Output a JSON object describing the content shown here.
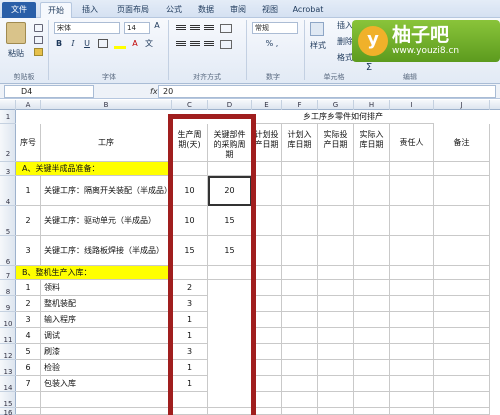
{
  "tabs": [
    "文件",
    "开始",
    "插入",
    "页面布局",
    "公式",
    "数据",
    "审阅",
    "视图",
    "Acrobat"
  ],
  "active_tab": "开始",
  "ribbon": {
    "paste_label": "粘贴",
    "font_name": "宋体",
    "font_size": "14",
    "number_format": "常规",
    "number_symbols": "% ,",
    "style_label": "样式",
    "insert_label": "插入",
    "delete_label": "删除",
    "format_label": "格式",
    "sum_symbol": "Σ",
    "bold": "B",
    "italic": "I",
    "underline": "U",
    "font_grow": "A",
    "font_color_a": "A",
    "wen": "文",
    "groups": [
      "剪贴板",
      "字体",
      "对齐方式",
      "数字",
      "单元格",
      "编辑"
    ]
  },
  "watermark": {
    "badge": "y",
    "title": "柚子吧",
    "url": "www.youzi8.cn"
  },
  "formula_bar": {
    "cell_ref": "D4",
    "fx": "fx",
    "value": "20"
  },
  "columns": [
    "A",
    "B",
    "C",
    "D",
    "E",
    "F",
    "G",
    "H",
    "I",
    "J"
  ],
  "sheet": {
    "banner": "乡工序乡零件如何排产",
    "headers": {
      "seq": "序号",
      "process": "工序",
      "cycle": "生产周期(天)",
      "purchase": "关键部件的采购周期",
      "plan_put": "计划投产日期",
      "plan_store": "计划入库日期",
      "actual_put": "实际投产日期",
      "actual_store": "实际入库日期",
      "owner": "责任人",
      "note": "备注"
    },
    "sections": [
      {
        "label": "A、关键半成品准备：",
        "rows": [
          {
            "seq": "1",
            "process": "关键工序：隔离开关装配（半成品）",
            "cycle": "10",
            "purchase": "20"
          },
          {
            "seq": "2",
            "process": "关键工序：驱动单元（半成品）",
            "cycle": "10",
            "purchase": "15"
          },
          {
            "seq": "3",
            "process": "关键工序：线路板焊接（半成品）",
            "cycle": "15",
            "purchase": "15"
          }
        ]
      },
      {
        "label": "B、整机生产入库：",
        "rows": [
          {
            "seq": "1",
            "process": "领料",
            "cycle": "2"
          },
          {
            "seq": "2",
            "process": "整机装配",
            "cycle": "3"
          },
          {
            "seq": "3",
            "process": "输入程序",
            "cycle": "1"
          },
          {
            "seq": "4",
            "process": "调试",
            "cycle": "1"
          },
          {
            "seq": "5",
            "process": "刷漆",
            "cycle": "3"
          },
          {
            "seq": "6",
            "process": "检验",
            "cycle": "1"
          },
          {
            "seq": "7",
            "process": "包装入库",
            "cycle": "1"
          }
        ]
      }
    ],
    "row_numbers": [
      "1",
      "2",
      "3",
      "4",
      "5",
      "6",
      "7",
      "8",
      "9",
      "10",
      "11",
      "12",
      "13",
      "14",
      "15",
      "16"
    ]
  },
  "colors": {
    "highlight": "#ffff00",
    "annotation_box": "#a01e1e",
    "file_tab": "#2a5fa8"
  }
}
